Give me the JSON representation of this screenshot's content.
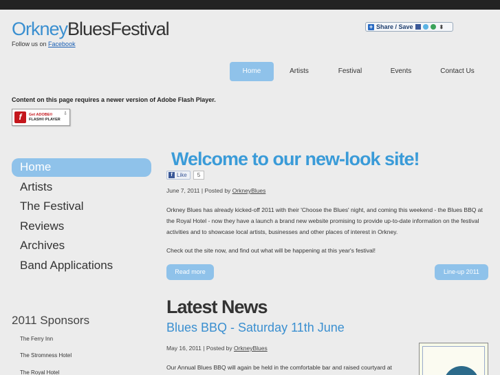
{
  "header": {
    "logo": {
      "part1": "Orkney",
      "part2": "Blues",
      "part3": "Festival"
    },
    "follow_text": "Follow us on",
    "follow_link": "Facebook",
    "share_label": "Share / Save",
    "share_arrow": "⬍"
  },
  "nav": {
    "items": [
      {
        "label": "Home",
        "active": true
      },
      {
        "label": "Artists"
      },
      {
        "label": "Festival"
      },
      {
        "label": "Events"
      },
      {
        "label": "Contact Us"
      }
    ]
  },
  "flash": {
    "message": "Content on this page requires a newer version of Adobe Flash Player.",
    "button_line1": "Get ",
    "button_adobe": "ADOBE®",
    "button_line2": "FLASH® PLAYER",
    "button_glyph": "f",
    "download_glyph": "⇩"
  },
  "sidebar": {
    "items": [
      {
        "label": "Home",
        "active": true
      },
      {
        "label": "Artists"
      },
      {
        "label": "The Festival"
      },
      {
        "label": "Reviews"
      },
      {
        "label": "Archives"
      },
      {
        "label": "Band Applications"
      }
    ],
    "sponsors_title": "2011 Sponsors",
    "sponsors": [
      "The Ferry Inn",
      "The Stromness Hotel",
      "The Royal Hotel"
    ]
  },
  "post1": {
    "title": "Welcome to our new-look site!",
    "like_label": "Like",
    "like_icon": "f",
    "like_count": "5",
    "date": "June 7, 2011",
    "separator": "|",
    "posted_by": "Posted by",
    "author": "OrkneyBlues",
    "para1": "Orkney Blues has already kicked-off 2011 with their 'Choose the Blues' night, and coming this weekend - the Blues BBQ at the Royal Hotel - now they have a launch a brand new website promising to provide up-to-date information on the festival activities and to showcase local artists, businesses and other places of interest in Orkney.",
    "para2": "Check out the site now, and find out what will be happening at this year's festival!",
    "read_more": "Read more",
    "lineup": "Line-up 2011"
  },
  "latest": {
    "heading": "Latest News",
    "title": "Blues BBQ - Saturday 11th June",
    "date": "May 16, 2011",
    "separator": "|",
    "posted_by": "Posted by",
    "author": "OrkneyBlues",
    "para": "Our Annual Blues BBQ will again be held in the comfortable bar and raised courtyard at"
  },
  "colors": {
    "accent": "#3a8fd0",
    "button": "#8fc2ea",
    "heading_blue": "#3a9bd8"
  }
}
